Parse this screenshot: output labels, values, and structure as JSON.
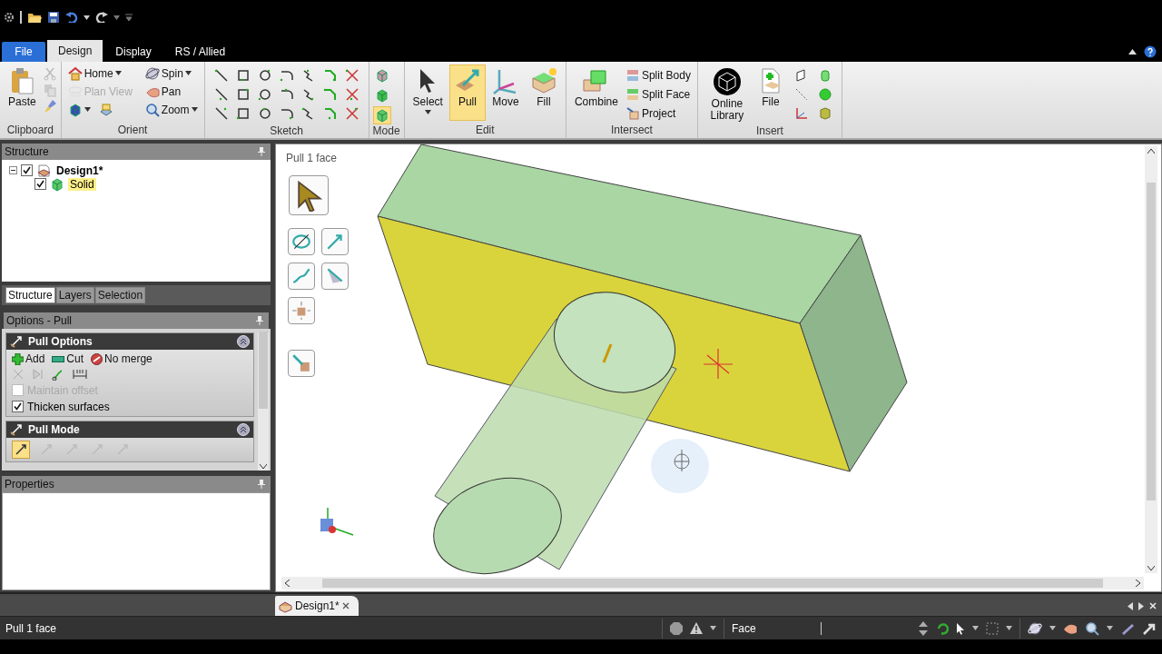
{
  "tabs": [
    {
      "label": "File",
      "kind": "file",
      "selected": false
    },
    {
      "label": "Design",
      "kind": "tab",
      "selected": true
    },
    {
      "label": "Display",
      "kind": "tab",
      "selected": false
    },
    {
      "label": "RS / Allied",
      "kind": "tab",
      "selected": false
    }
  ],
  "ribbon": {
    "clipboard": {
      "label": "Clipboard",
      "paste": "Paste"
    },
    "orient": {
      "label": "Orient",
      "items": [
        {
          "kind": "button",
          "label": "Home",
          "dropdown": true,
          "disabled": false
        },
        {
          "kind": "button",
          "label": "Spin",
          "dropdown": true,
          "disabled": false
        },
        {
          "kind": "button",
          "label": "Plan View",
          "dropdown": false,
          "disabled": true
        },
        {
          "kind": "button",
          "label": "Pan",
          "dropdown": false,
          "disabled": false
        },
        {
          "kind": "views",
          "dropdown": true,
          "disabled": false
        },
        {
          "kind": "button",
          "label": "Zoom",
          "dropdown": true,
          "disabled": false
        }
      ]
    },
    "sketch": {
      "label": "Sketch"
    },
    "mode": {
      "label": "Mode",
      "buttons": [
        {
          "selected": false
        },
        {
          "selected": false
        },
        {
          "selected": true
        }
      ]
    },
    "edit": {
      "label": "Edit",
      "buttons": [
        {
          "label": "Select",
          "dropdown": true,
          "selected": false
        },
        {
          "label": "Pull",
          "dropdown": false,
          "selected": true
        },
        {
          "label": "Move",
          "dropdown": false,
          "selected": false
        },
        {
          "label": "Fill",
          "dropdown": false,
          "selected": false
        }
      ]
    },
    "intersect": {
      "label": "Intersect",
      "big": "Combine",
      "small": [
        "Split Body",
        "Split Face",
        "Project"
      ]
    },
    "insert": {
      "label": "Insert",
      "big": [
        "Online Library",
        "File"
      ]
    }
  },
  "structure": {
    "title": "Structure",
    "tree": [
      {
        "label": "Design1*",
        "checked": true,
        "expanded": true,
        "selected": false,
        "children": [
          {
            "label": "Solid",
            "checked": true,
            "selected": true
          }
        ]
      }
    ]
  },
  "panel_tabs": [
    {
      "label": "Structure",
      "selected": true
    },
    {
      "label": "Layers",
      "selected": false
    },
    {
      "label": "Selection",
      "selected": false
    }
  ],
  "options": {
    "title": "Options - Pull",
    "sections": [
      {
        "title": "Pull Options",
        "actions": [
          "Add",
          "Cut",
          "No merge"
        ],
        "checkboxes": [
          {
            "label": "Maintain offset",
            "checked": false,
            "disabled": true
          },
          {
            "label": "Thicken surfaces",
            "checked": true,
            "disabled": false
          }
        ]
      },
      {
        "title": "Pull Mode",
        "tools": [
          {
            "selected": true
          },
          {
            "selected": false
          },
          {
            "selected": false
          },
          {
            "selected": false
          },
          {
            "selected": false
          }
        ]
      }
    ]
  },
  "properties": {
    "title": "Properties"
  },
  "viewport": {
    "hint": "Pull 1 face"
  },
  "documents": [
    {
      "label": "Design1*",
      "selected": true
    }
  ],
  "status": {
    "message": "Pull 1 face",
    "filter": "Face"
  }
}
